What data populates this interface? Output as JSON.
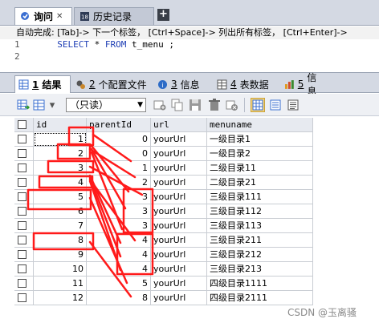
{
  "top_tabs": [
    {
      "label": "询问",
      "active": true
    },
    {
      "label": "历史记录",
      "active": false
    }
  ],
  "new_tab_symbol": "+",
  "hint": "自动完成: [Tab]-> 下一个标签， [Ctrl+Space]-> 列出所有标签， [Ctrl+Enter]->",
  "editor": {
    "line_numbers": [
      "1",
      "2"
    ],
    "sql": {
      "kw1": "SELECT",
      "star": "*",
      "kw2": "FROM",
      "table": "t_menu",
      "end": ";"
    }
  },
  "result_tabs": [
    {
      "num": "1",
      "label": "结果"
    },
    {
      "num": "2",
      "label": "个配置文件"
    },
    {
      "num": "3",
      "label": "信息"
    },
    {
      "num": "4",
      "label": "表数据"
    },
    {
      "num": "5",
      "label": "信息"
    }
  ],
  "toolbar": {
    "readonly": "（只读）"
  },
  "grid": {
    "columns": [
      "id",
      "parentId",
      "url",
      "menuname"
    ],
    "rows": [
      {
        "id": "1",
        "parentId": "0",
        "url": "yourUrl",
        "menuname": "一级目录1"
      },
      {
        "id": "2",
        "parentId": "0",
        "url": "yourUrl",
        "menuname": "一级目录2"
      },
      {
        "id": "3",
        "parentId": "1",
        "url": "yourUrl",
        "menuname": "二级目录11"
      },
      {
        "id": "4",
        "parentId": "2",
        "url": "yourUrl",
        "menuname": "二级目录21"
      },
      {
        "id": "5",
        "parentId": "3",
        "url": "yourUrl",
        "menuname": "三级目录111"
      },
      {
        "id": "6",
        "parentId": "3",
        "url": "yourUrl",
        "menuname": "三级目录112"
      },
      {
        "id": "7",
        "parentId": "3",
        "url": "yourUrl",
        "menuname": "三级目录113"
      },
      {
        "id": "8",
        "parentId": "4",
        "url": "yourUrl",
        "menuname": "三级目录211"
      },
      {
        "id": "9",
        "parentId": "4",
        "url": "yourUrl",
        "menuname": "三级目录212"
      },
      {
        "id": "10",
        "parentId": "4",
        "url": "yourUrl",
        "menuname": "三级目录213"
      },
      {
        "id": "11",
        "parentId": "5",
        "url": "yourUrl",
        "menuname": "四级目录1111"
      },
      {
        "id": "12",
        "parentId": "8",
        "url": "yourUrl",
        "menuname": "四级目录2111"
      }
    ]
  },
  "colors": {
    "annotation": "#ff1a1a",
    "header_bg": "#e7eaf0",
    "tabbar_bg": "#d4d9e3"
  },
  "watermark": "CSDN @玉离骚"
}
